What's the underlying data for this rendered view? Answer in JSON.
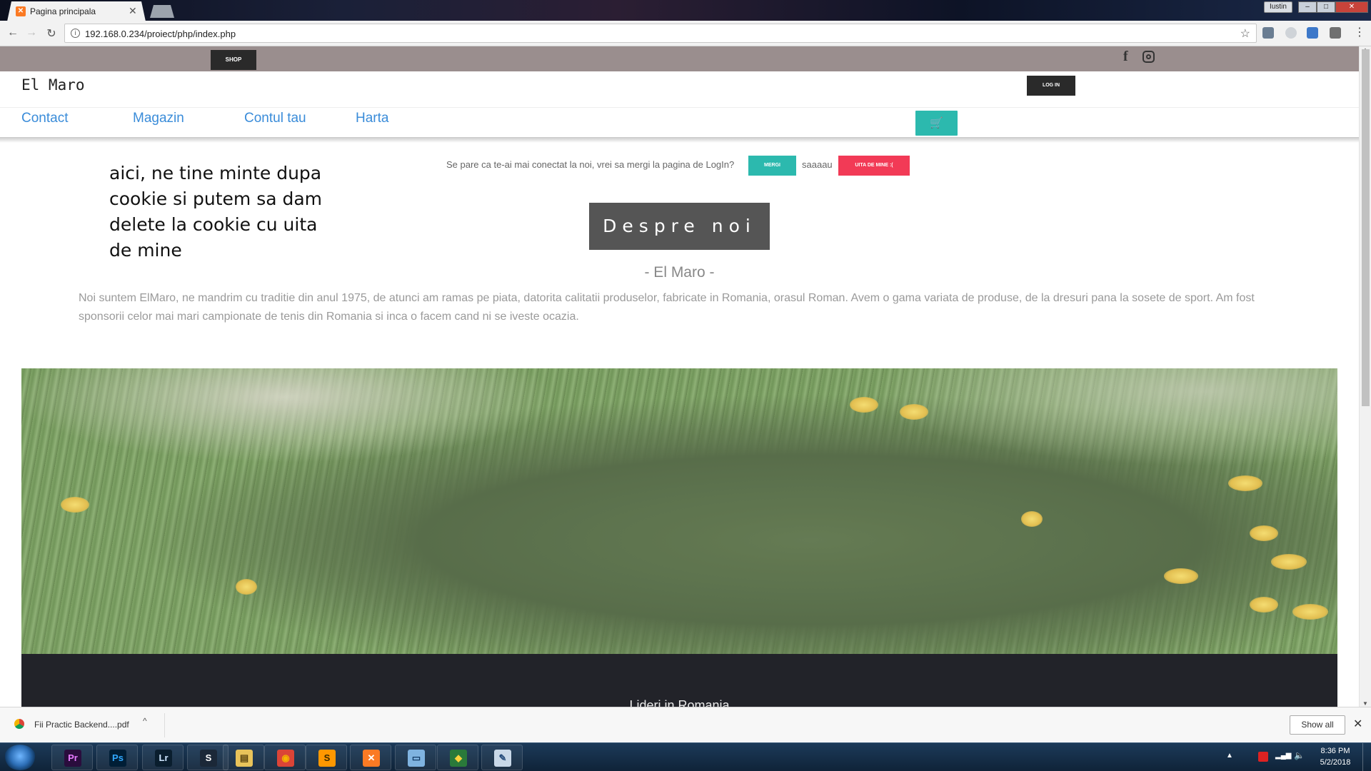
{
  "browser": {
    "tab_title": "Pagina principala",
    "tab_close": "✕",
    "tab_favicon": "✕",
    "url": "192.168.0.234/proiect/php/index.php",
    "window_user": "Iustin",
    "back_icon": "←",
    "forward_icon": "→",
    "reload_icon": "↻",
    "star_icon": "☆",
    "menu_icon": "⋮",
    "info_icon": "i"
  },
  "page": {
    "shop_label": "SHOP",
    "facebook_glyph": "f",
    "brand": "El Maro",
    "login_label": "LOG IN",
    "nav": {
      "contact": "Contact",
      "magazin": "Magazin",
      "cont": "Contul tau",
      "harta": "Harta"
    },
    "cart_glyph": "🛒",
    "annotation": "aici, ne tine minte dupa cookie si putem sa dam delete la cookie cu uita de mine",
    "cookie": {
      "text": "Se pare ca te-ai mai conectat la noi, vrei sa mergi la pagina de LogIn?",
      "mergi_label": "MERGI",
      "or_text": "saaaau",
      "uita_label": "UITA DE MINE :("
    },
    "despre_title": "Despre noi",
    "subtitle": "- El Maro -",
    "about_text": "Noi suntem ElMaro, ne mandrim cu traditie din anul 1975, de atunci am ramas pe piata, datorita calitatii produselor, fabricate in Romania, orasul Roman. Avem o gama variata de produse, de la dresuri pana la sosete de sport. Am fost sponsorii celor mai mari campionate de tenis din Romania si inca o facem cand ni se iveste ocazia.",
    "hero_caption": "Lideri in Romania"
  },
  "downloads": {
    "file_name": "Fii Practic Backend....pdf",
    "caret": "^",
    "show_all": "Show all",
    "close": "✕"
  },
  "taskbar": {
    "apps": [
      {
        "name": "premiere",
        "glyph": "Pr",
        "color": "#2a0d3d",
        "fg": "#e77bff"
      },
      {
        "name": "photoshop",
        "glyph": "Ps",
        "color": "#001e36",
        "fg": "#31a8ff"
      },
      {
        "name": "lightroom",
        "glyph": "Lr",
        "color": "#0a1e2e",
        "fg": "#cfe6ff"
      },
      {
        "name": "steam",
        "glyph": "S",
        "color": "#1b2838",
        "fg": "#ffffff"
      },
      {
        "name": "explorer",
        "glyph": "▤",
        "color": "#e8c35a",
        "fg": "#5a4410"
      },
      {
        "name": "chrome",
        "glyph": "◉",
        "color": "#db4437",
        "fg": "#f4b400"
      },
      {
        "name": "sublime",
        "glyph": "S",
        "color": "#ff9800",
        "fg": "#3a2a00"
      },
      {
        "name": "xampp",
        "glyph": "✕",
        "color": "#fb7a24",
        "fg": "#ffffff"
      },
      {
        "name": "remote",
        "glyph": "▭",
        "color": "#7fb3e0",
        "fg": "#123b66"
      },
      {
        "name": "sourcetree",
        "glyph": "◆",
        "color": "#2a7a3a",
        "fg": "#ffd23d"
      },
      {
        "name": "paint",
        "glyph": "✎",
        "color": "#c9d8e8",
        "fg": "#244a7a"
      }
    ],
    "time": "8:36 PM",
    "date": "5/2/2018"
  }
}
